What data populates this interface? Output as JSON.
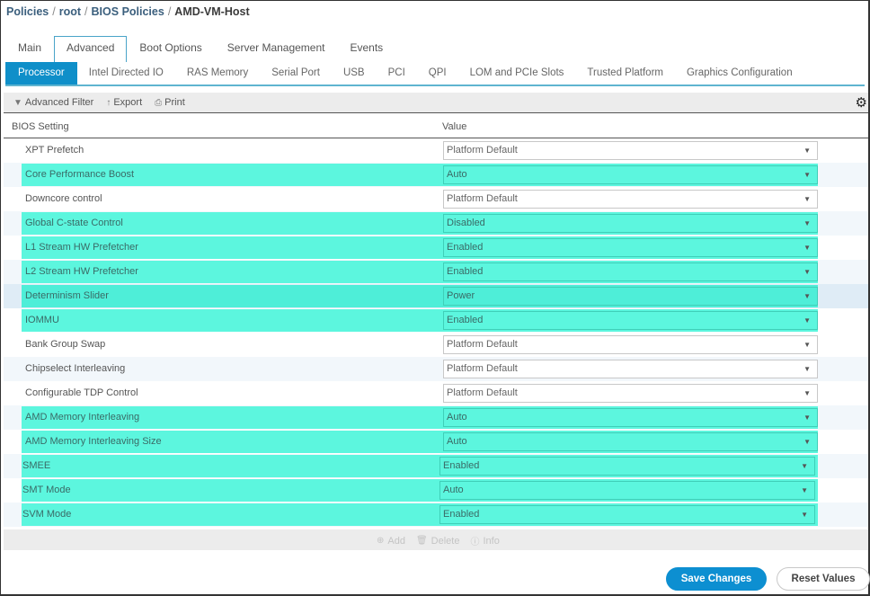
{
  "breadcrumb": {
    "items": [
      "Policies",
      "root",
      "BIOS Policies"
    ],
    "current": "AMD-VM-Host",
    "separator": "/"
  },
  "top_tabs": [
    {
      "label": "Main",
      "active": false
    },
    {
      "label": "Advanced",
      "active": true
    },
    {
      "label": "Boot Options",
      "active": false
    },
    {
      "label": "Server Management",
      "active": false
    },
    {
      "label": "Events",
      "active": false
    }
  ],
  "sub_tabs": [
    {
      "label": "Processor",
      "active": true
    },
    {
      "label": "Intel Directed IO",
      "active": false
    },
    {
      "label": "RAS Memory",
      "active": false
    },
    {
      "label": "Serial Port",
      "active": false
    },
    {
      "label": "USB",
      "active": false
    },
    {
      "label": "PCI",
      "active": false
    },
    {
      "label": "QPI",
      "active": false
    },
    {
      "label": "LOM and PCIe Slots",
      "active": false
    },
    {
      "label": "Trusted Platform",
      "active": false
    },
    {
      "label": "Graphics Configuration",
      "active": false
    }
  ],
  "toolbar": {
    "advanced_filter": "Advanced Filter",
    "export": "Export",
    "print": "Print",
    "icons": {
      "filter": "filter-icon",
      "export": "export-arrow-icon",
      "print": "printer-icon",
      "settings": "gear-icon"
    }
  },
  "table": {
    "columns": [
      "BIOS Setting",
      "Value"
    ],
    "rows": [
      {
        "setting": "XPT Prefetch",
        "value": "Platform Default",
        "highlighted": false
      },
      {
        "setting": "Core Performance Boost",
        "value": "Auto",
        "highlighted": true
      },
      {
        "setting": "Downcore control",
        "value": "Platform Default",
        "highlighted": false
      },
      {
        "setting": "Global C-state Control",
        "value": "Disabled",
        "highlighted": true
      },
      {
        "setting": "L1 Stream HW Prefetcher",
        "value": "Enabled",
        "highlighted": true
      },
      {
        "setting": "L2 Stream HW Prefetcher",
        "value": "Enabled",
        "highlighted": true
      },
      {
        "setting": "Determinism Slider",
        "value": "Power",
        "highlighted": true
      },
      {
        "setting": "IOMMU",
        "value": "Enabled",
        "highlighted": true
      },
      {
        "setting": "Bank Group Swap",
        "value": "Platform Default",
        "highlighted": false
      },
      {
        "setting": "Chipselect Interleaving",
        "value": "Platform Default",
        "highlighted": false
      },
      {
        "setting": "Configurable TDP Control",
        "value": "Platform Default",
        "highlighted": false
      },
      {
        "setting": "AMD Memory Interleaving",
        "value": "Auto",
        "highlighted": true
      },
      {
        "setting": "AMD Memory Interleaving Size",
        "value": "Auto",
        "highlighted": true
      },
      {
        "setting": "SMEE",
        "value": "Enabled",
        "highlighted": true
      },
      {
        "setting": "SMT Mode",
        "value": "Auto",
        "highlighted": true
      },
      {
        "setting": "SVM Mode",
        "value": "Enabled",
        "highlighted": true
      }
    ]
  },
  "footer_actions": {
    "add": "Add",
    "delete": "Delete",
    "info": "Info"
  },
  "buttons": {
    "save": "Save Changes",
    "reset": "Reset Values"
  },
  "colors": {
    "highlight": "#5cf6de",
    "active_tab": "#0f8fc9",
    "save_button": "#0d8fd1",
    "breadcrumb_link": "#3b5f7d"
  }
}
